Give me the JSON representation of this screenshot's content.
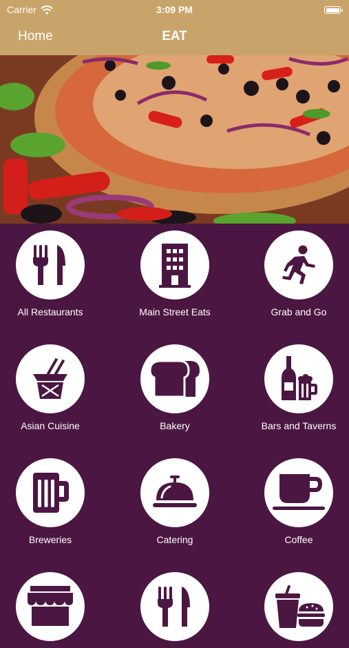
{
  "status_bar": {
    "carrier": "Carrier",
    "time": "3:09 PM"
  },
  "nav": {
    "back_label": "Home",
    "title": "EAT"
  },
  "hero": {
    "alt": "pizza photo"
  },
  "categories": [
    {
      "label": "All Restaurants",
      "icon": "fork-knife-icon"
    },
    {
      "label": "Main Street Eats",
      "icon": "building-icon"
    },
    {
      "label": "Grab and Go",
      "icon": "running-person-icon"
    },
    {
      "label": "Asian Cuisine",
      "icon": "takeout-box-icon"
    },
    {
      "label": "Bakery",
      "icon": "bread-icon"
    },
    {
      "label": "Bars and Taverns",
      "icon": "bottle-mug-icon"
    },
    {
      "label": "Breweries",
      "icon": "beer-mug-icon"
    },
    {
      "label": "Catering",
      "icon": "cloche-icon"
    },
    {
      "label": "Coffee",
      "icon": "coffee-cup-icon"
    },
    {
      "label": "",
      "icon": "storefront-icon"
    },
    {
      "label": "",
      "icon": "fork-knife-icon"
    },
    {
      "label": "",
      "icon": "drink-burger-icon"
    }
  ],
  "colors": {
    "nav_bg": "#c9a46a",
    "grid_bg": "#4b1742",
    "icon": "#4b1742"
  }
}
